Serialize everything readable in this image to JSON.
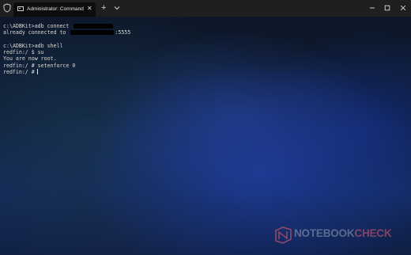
{
  "window": {
    "tab_title": "Administrator: Command Prompt",
    "new_tab_label": "+",
    "tab_close_label": "✕"
  },
  "terminal": {
    "line1_cmd": "c:\\ADBKit>adb connect ",
    "line2_prefix": "already connected to ",
    "line2_suffix": ":5555",
    "line4": "c:\\ADBKit>adb shell",
    "line5": "redfin:/ $ su",
    "line6": "You are now root.",
    "line7": "redfin:/ # setenforce 0",
    "line8": "redfin:/ #"
  },
  "watermark": {
    "text_a": "NOTEBOOK",
    "text_b": "CHECK"
  },
  "colors": {
    "titlebar": "#1f1f1f",
    "tab": "#0c0c0c",
    "terminal_text": "#d8d8d8"
  }
}
